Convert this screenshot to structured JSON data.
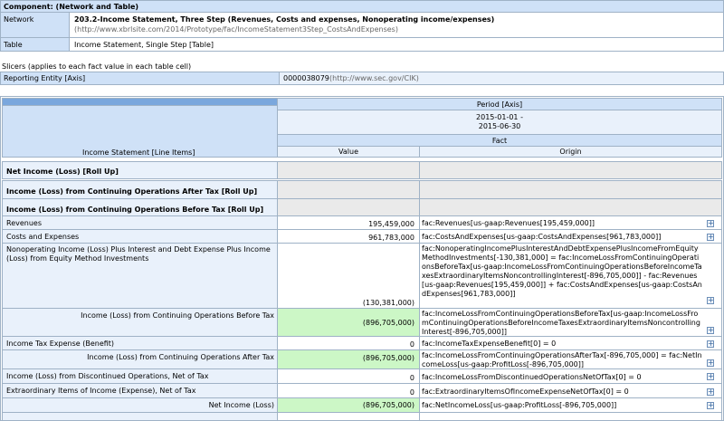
{
  "component": {
    "header": "Component: (Network and Table)",
    "network_label": "Network",
    "network_title": "203.2-Income Statement, Three Step (Revenues, Costs and expenses, Nonoperating income/expenses)",
    "network_url": "(http://www.xbrlsite.com/2014/Prototype/fac/IncomeStatement3Step_CostsAndExpenses)",
    "table_label": "Table",
    "table_value": "Income Statement, Single Step [Table]"
  },
  "slicers": {
    "caption": "Slicers (applies to each fact value in each table cell)",
    "entity_label": "Reporting Entity [Axis]",
    "entity_value": "0000038079",
    "entity_url": "(http://www.sec.gov/CIK)"
  },
  "grid": {
    "period_axis": "Period [Axis]",
    "period_line1": "2015-01-01 -",
    "period_line2": "2015-06-30",
    "fact": "Fact",
    "line_items": "Income Statement [Line Items]",
    "col_value": "Value",
    "col_origin": "Origin",
    "expand_icon": "plus-box-icon",
    "rows": [
      {
        "label": "Net Income (Loss) [Roll Up]",
        "value": "",
        "origin": ""
      },
      {
        "label": "Income (Loss) from Continuing Operations After Tax [Roll Up]",
        "value": "",
        "origin": ""
      },
      {
        "label": "Income (Loss) from Continuing Operations Before Tax [Roll Up]",
        "value": "",
        "origin": ""
      },
      {
        "label": "Revenues",
        "value": "195,459,000",
        "origin": "fac:Revenues[us-gaap:Revenues[195,459,000]]"
      },
      {
        "label": "Costs and Expenses",
        "value": "961,783,000",
        "origin": "fac:CostsAndExpenses[us-gaap:CostsAndExpenses[961,783,000]]"
      },
      {
        "label": "Nonoperating Income (Loss) Plus Interest and Debt Expense Plus Income (Loss) from Equity Method Investments",
        "value": "(130,381,000)",
        "origin": "fac:NonoperatingIncomePlusInterestAndDebtExpensePlusIncomeFromEquityMethodInvestments[-130,381,000] = fac:IncomeLossFromContinuingOperationsBeforeTax[us-gaap:IncomeLossFromContinuingOperationsBeforeIncomeTaxesExtraordinaryItemsNoncontrollingInterest[-896,705,000]] - fac:Revenues[us-gaap:Revenues[195,459,000]] + fac:CostsAndExpenses[us-gaap:CostsAndExpenses[961,783,000]]"
      },
      {
        "label": "Income (Loss) from Continuing Operations Before Tax",
        "value": "(896,705,000)",
        "origin": "fac:IncomeLossFromContinuingOperationsBeforeTax[us-gaap:IncomeLossFromContinuingOperationsBeforeIncomeTaxesExtraordinaryItemsNoncontrollingInterest[-896,705,000]]"
      },
      {
        "label": "Income Tax Expense (Benefit)",
        "value": "0",
        "origin": "fac:IncomeTaxExpenseBenefit[0] = 0"
      },
      {
        "label": "Income (Loss) from Continuing Operations After Tax",
        "value": "(896,705,000)",
        "origin": "fac:IncomeLossFromContinuingOperationsAfterTax[-896,705,000] = fac:NetIncomeLoss[us-gaap:ProfitLoss[-896,705,000]]"
      },
      {
        "label": "Income (Loss) from Discontinued Operations, Net of Tax",
        "value": "0",
        "origin": "fac:IncomeLossFromDiscontinuedOperationsNetOfTax[0] = 0"
      },
      {
        "label": "Extraordinary Items of Income (Expense), Net of Tax",
        "value": "0",
        "origin": "fac:ExtraordinaryItemsOfIncomeExpenseNetOfTax[0] = 0"
      },
      {
        "label": "Net Income (Loss)",
        "value": "(896,705,000)",
        "origin": "fac:NetIncomeLoss[us-gaap:ProfitLoss[-896,705,000]]"
      }
    ]
  }
}
